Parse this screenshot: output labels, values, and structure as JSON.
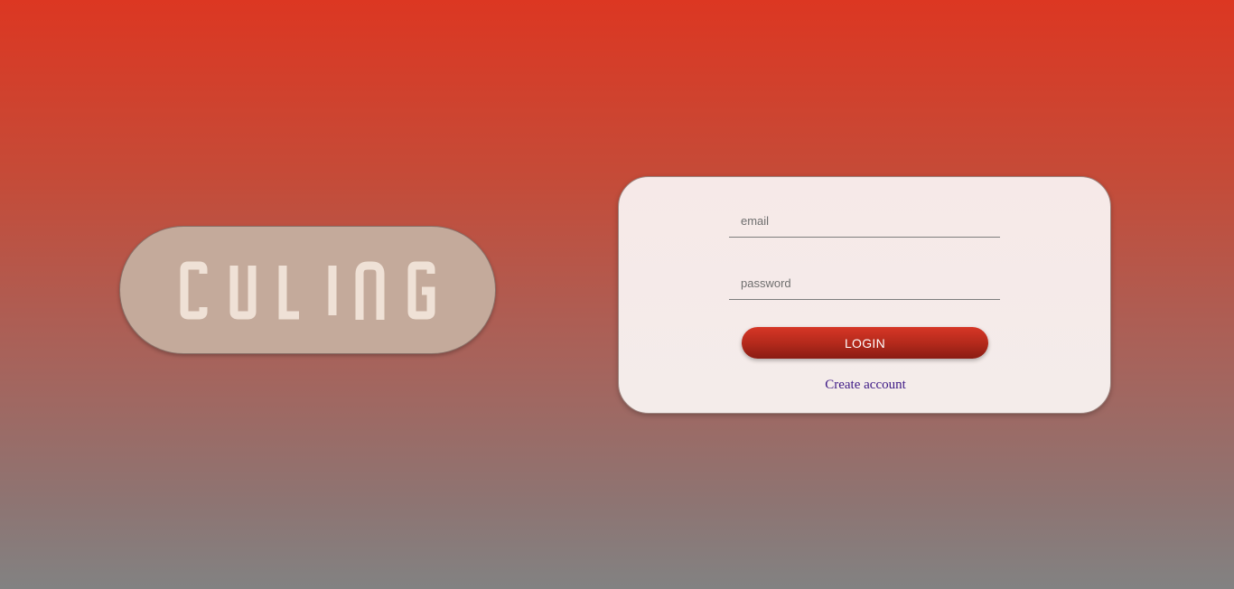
{
  "brand": {
    "logo_text": "CULING",
    "logo_color": "#efe1d6",
    "pill_color": "#c4aa9b"
  },
  "login": {
    "email_placeholder": "email",
    "password_placeholder": "password",
    "login_label": "LOGIN",
    "create_account_label": "Create account"
  },
  "colors": {
    "background_top": "#dc3722",
    "background_bottom": "#828282",
    "button": "#b52a1c",
    "link": "#3d1a86"
  }
}
